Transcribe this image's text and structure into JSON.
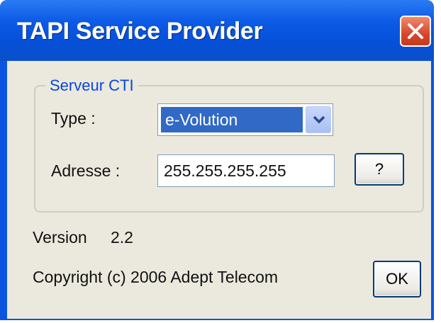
{
  "window": {
    "title": "TAPI Service Provider"
  },
  "group": {
    "legend": "Serveur CTI",
    "type_label": "Type :",
    "type_selected": "e-Volution",
    "address_label": "Adresse :",
    "address_value": "255.255.255.255",
    "help_button_label": "?"
  },
  "footer": {
    "version_label": "Version",
    "version_value": "2.2",
    "copyright": "Copyright (c) 2006 Adept Telecom",
    "ok_label": "OK"
  },
  "colors": {
    "titlebar": "#0a55e0",
    "close_button": "#d9462a",
    "dialog_background": "#ebe9dd",
    "selection": "#3169c6",
    "group_legend_text": "#0b46d8"
  },
  "icons": [
    "close-icon",
    "chevron-down-icon"
  ]
}
